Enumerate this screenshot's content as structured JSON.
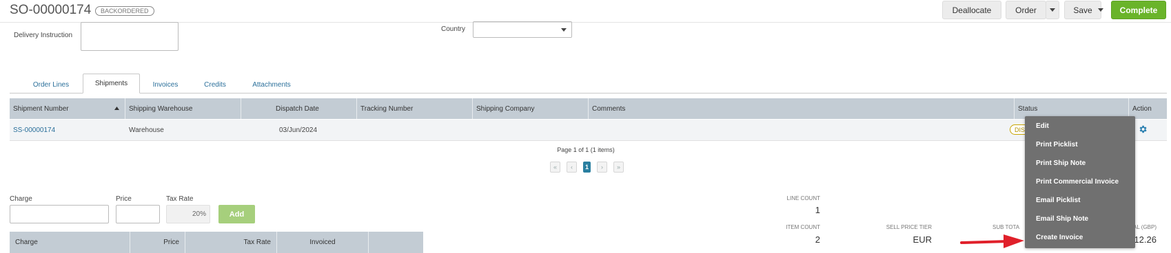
{
  "header": {
    "title": "SO-00000174",
    "status_badge": "BACKORDERED",
    "buttons": {
      "deallocate": "Deallocate",
      "order": "Order",
      "save": "Save",
      "complete": "Complete"
    }
  },
  "form": {
    "delivery_instruction_label": "Delivery Instruction",
    "delivery_instruction_value": "",
    "country_label": "Country",
    "country_value": ""
  },
  "tabs": [
    {
      "label": "Order Lines",
      "active": false
    },
    {
      "label": "Shipments",
      "active": true
    },
    {
      "label": "Invoices",
      "active": false
    },
    {
      "label": "Credits",
      "active": false
    },
    {
      "label": "Attachments",
      "active": false
    }
  ],
  "shipments_table": {
    "columns": [
      "Shipment Number",
      "Shipping Warehouse",
      "Dispatch Date",
      "Tracking Number",
      "Shipping Company",
      "Comments",
      "Status",
      "Action"
    ],
    "rows": [
      {
        "shipment_number": "SS-00000174",
        "shipping_warehouse": "Warehouse",
        "dispatch_date": "03/Jun/2024",
        "tracking_number": "",
        "shipping_company": "",
        "comments": "",
        "status": "DIS"
      }
    ]
  },
  "pager": {
    "info": "Page 1 of 1 (1 items)",
    "current": "1",
    "first": "«",
    "prev": "‹",
    "next": "›",
    "last": "»"
  },
  "charge_form": {
    "charge_label": "Charge",
    "price_label": "Price",
    "tax_rate_label": "Tax Rate",
    "tax_rate_value": "20%",
    "add_label": "Add",
    "charge_value": "",
    "price_value": ""
  },
  "charges_table": {
    "columns": [
      "Charge",
      "Price",
      "Tax Rate",
      "Invoiced"
    ]
  },
  "stats": {
    "line_count_label": "LINE COUNT",
    "line_count": "1",
    "item_count_label": "ITEM COUNT",
    "item_count": "2",
    "sell_price_tier_label": "SELL PRICE TIER",
    "sell_price_tier": "EUR",
    "sub_total_label": "SUB TOTA",
    "total_label": "AL (GBP)",
    "total_value": "12.26"
  },
  "action_menu": {
    "items": [
      "Edit",
      "Print Picklist",
      "Print Ship Note",
      "Print Commercial Invoice",
      "Email Picklist",
      "Email Ship Note",
      "Create Invoice"
    ]
  },
  "colors": {
    "accent": "#2a6f9a",
    "complete_green": "#6ab42a",
    "add_green": "#a6cf7c",
    "table_header": "#c3ccd4",
    "menu_bg": "#707070",
    "arrow_red": "#e0202a"
  },
  "icons": [
    "caret-down-icon",
    "sort-asc-icon",
    "gear-icon",
    "arrow-icon"
  ]
}
